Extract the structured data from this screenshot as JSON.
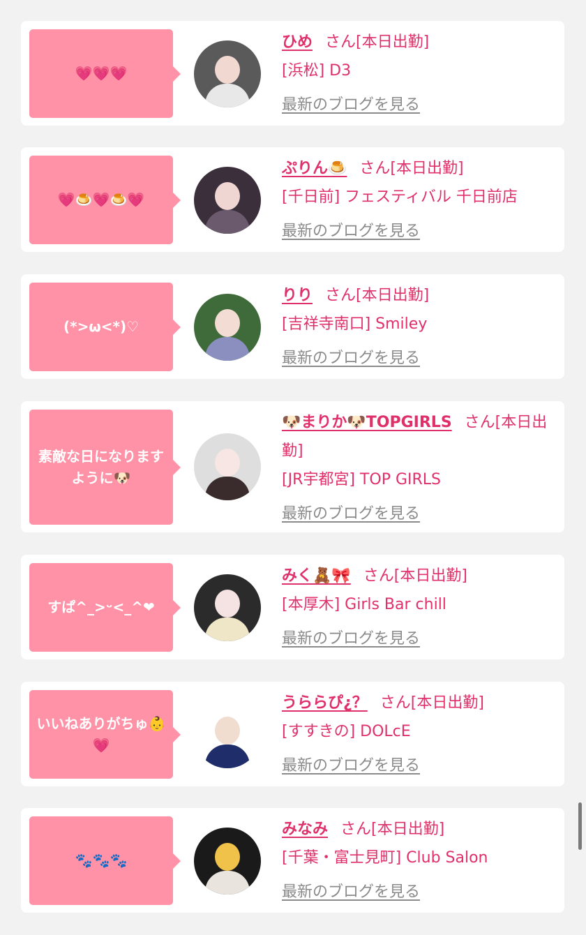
{
  "name_suffix": "さん[本日出勤]",
  "blog_link_text": "最新のブログを見る",
  "colors": {
    "background": "#f2f2f2",
    "bubble": "#ff92a6",
    "accent": "#e0306a",
    "link_gray": "#8a8a8a"
  },
  "entries": [
    {
      "message": "💗💗💗",
      "name": "ひめ",
      "shop": "[浜松] D3",
      "avatar_colors": [
        "#5a5a5a",
        "#f1d9d2",
        "#e8e8e8"
      ]
    },
    {
      "message": "💗🍮💗🍮💗",
      "name": "ぷりん🍮",
      "shop": "[千日前] フェスティバル 千日前店",
      "avatar_colors": [
        "#3a2f3a",
        "#f0d6d2",
        "#6b5a6e"
      ]
    },
    {
      "message": "(*>ω<*)♡",
      "name": "りり",
      "shop": "[吉祥寺南口] Smiley",
      "avatar_colors": [
        "#3f6b3a",
        "#f2dcd3",
        "#8a8fbf"
      ]
    },
    {
      "message": "素敵な日になりますように🐶",
      "name": "🐶まりか🐶TOPGIRLS",
      "name_suffix_wrapped": "さん[本日出勤]",
      "shop": "[JR宇都宮] TOP GIRLS",
      "avatar_colors": [
        "#dedede",
        "#f7e6e3",
        "#3a2c2c"
      ]
    },
    {
      "message": "すぱ^_>ᵕ<_^❤",
      "name": "みく🧸🎀",
      "shop": "[本厚木] Girls Bar chill",
      "avatar_colors": [
        "#2b2b2b",
        "#f5e2e2",
        "#efe6c8"
      ]
    },
    {
      "message": "いいねありがちゅ👶💗",
      "name": "うららぴ¿？",
      "shop": "[すすきの] DOLcE",
      "avatar_colors": [
        "#ffffff",
        "#f1dcd0",
        "#1f2d6b"
      ]
    },
    {
      "message": "🐾🐾🐾",
      "name": "みなみ",
      "shop": "[千葉・富士見町] Club Salon",
      "avatar_colors": [
        "#1a1a1a",
        "#f0c24a",
        "#e9e4de"
      ]
    }
  ]
}
